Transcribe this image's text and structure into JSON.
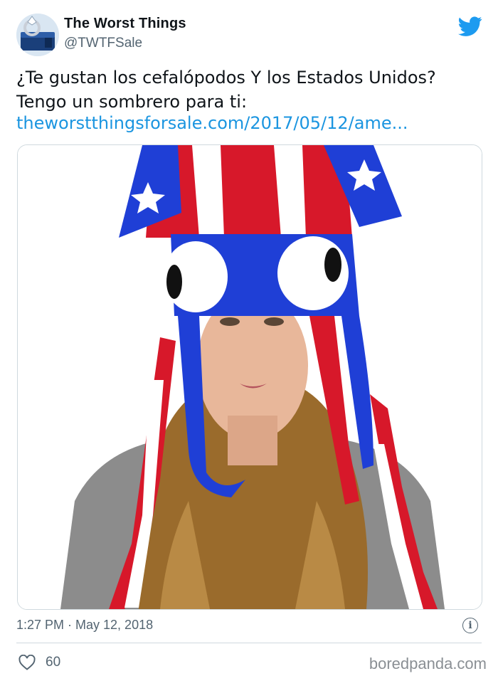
{
  "tweet": {
    "author_name": "The Worst Things",
    "author_handle": "@TWTFSale",
    "text": "¿Te gustan los cefalópodos Y los Estados Unidos?\nTengo un sombrero para ti:",
    "link_text": "theworstthingsforsale.com/2017/05/12/ame...",
    "timestamp": "1:27 PM · May 12, 2018",
    "likes": "60",
    "info_glyph": "i"
  },
  "icons": {
    "avatar": "jewelry-ring-avatar",
    "platform": "twitter-bird-icon",
    "like": "heart-icon",
    "info": "info-icon"
  },
  "watermark": "boredpanda.com",
  "colors": {
    "link": "#1b95e0",
    "twitter_blue": "#1d9bf0",
    "muted": "#536471",
    "hat_red": "#d7182a",
    "hat_blue": "#1f3fd6"
  }
}
